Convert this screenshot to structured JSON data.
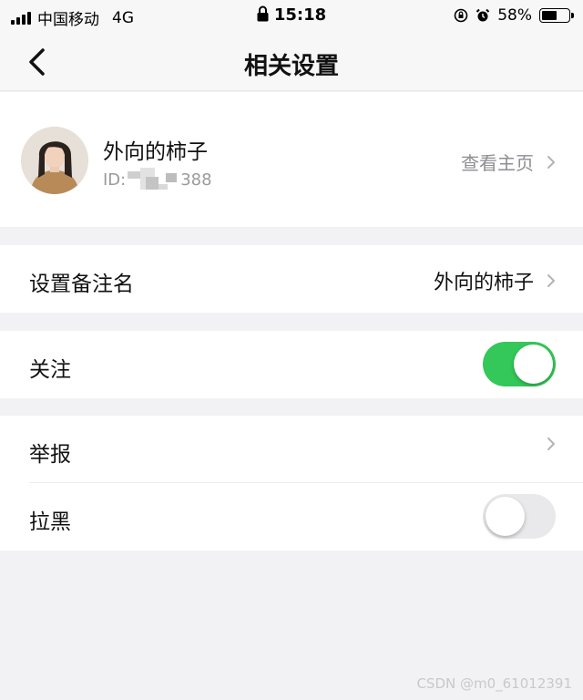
{
  "status_bar": {
    "carrier": "中国移动",
    "network": "4G",
    "time": "15:18",
    "battery": "58%",
    "battery_level": 0.58
  },
  "nav": {
    "title": "相关设置",
    "back_icon": "chevron-left-icon"
  },
  "profile": {
    "nickname": "外向的柿子",
    "id_prefix": "ID:",
    "id_suffix": "388",
    "view_home_label": "查看主页"
  },
  "rows": {
    "remark": {
      "label": "设置备注名",
      "value": "外向的柿子"
    },
    "follow": {
      "label": "关注",
      "toggle_on": true
    },
    "report": {
      "label": "举报"
    },
    "block": {
      "label": "拉黑",
      "toggle_on": false
    }
  },
  "colors": {
    "toggle_on": "#34c759",
    "toggle_off": "#e9e9eb",
    "background": "#f2f2f4"
  },
  "watermark": "CSDN @m0_61012391"
}
